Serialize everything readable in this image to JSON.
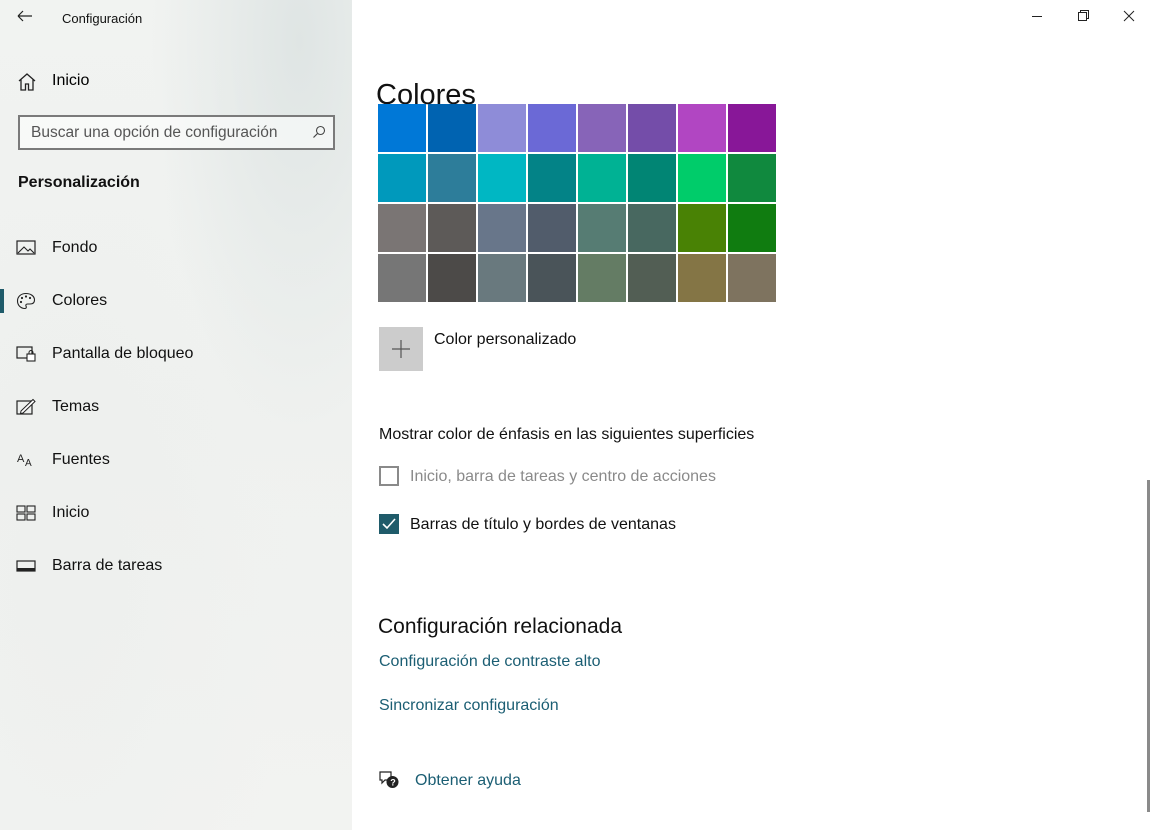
{
  "window": {
    "title": "Configuración"
  },
  "sidebar": {
    "home_label": "Inicio",
    "search_placeholder": "Buscar una opción de configuración",
    "section_title": "Personalización",
    "items": [
      {
        "label": "Fondo",
        "icon": "picture-icon",
        "selected": false
      },
      {
        "label": "Colores",
        "icon": "palette-icon",
        "selected": true
      },
      {
        "label": "Pantalla de bloqueo",
        "icon": "lock-screen-icon",
        "selected": false
      },
      {
        "label": "Temas",
        "icon": "themes-icon",
        "selected": false
      },
      {
        "label": "Fuentes",
        "icon": "fonts-icon",
        "selected": false
      },
      {
        "label": "Inicio",
        "icon": "start-icon",
        "selected": false
      },
      {
        "label": "Barra de tareas",
        "icon": "taskbar-icon",
        "selected": false
      }
    ]
  },
  "main": {
    "title": "Colores",
    "swatches": [
      [
        "#0078d7",
        "#0063b1",
        "#8e8cd8",
        "#6b69d6",
        "#8764b8",
        "#744da9",
        "#b146c2",
        "#881798"
      ],
      [
        "#0099bc",
        "#2d7d9a",
        "#00b7c3",
        "#038387",
        "#00b294",
        "#018574",
        "#00cc6a",
        "#10893e"
      ],
      [
        "#7a7574",
        "#5d5a58",
        "#68768a",
        "#515c6b",
        "#567c73",
        "#486860",
        "#498205",
        "#107c10"
      ],
      [
        "#767676",
        "#4c4a48",
        "#69797e",
        "#4a5459",
        "#647c64",
        "#525e54",
        "#847545",
        "#7e735f"
      ]
    ],
    "custom_color_label": "Color personalizado",
    "accent_heading": "Mostrar color de énfasis en las siguientes superficies",
    "checkboxes": [
      {
        "label": "Inicio, barra de tareas y centro de acciones",
        "checked": false,
        "disabled": true
      },
      {
        "label": "Barras de título y bordes de ventanas",
        "checked": true,
        "disabled": false
      }
    ],
    "related_heading": "Configuración relacionada",
    "links": [
      "Configuración de contraste alto",
      "Sincronizar configuración"
    ],
    "help_label": "Obtener ayuda"
  },
  "colors": {
    "accent": "#1f5b6a",
    "link": "#1b5e73"
  }
}
